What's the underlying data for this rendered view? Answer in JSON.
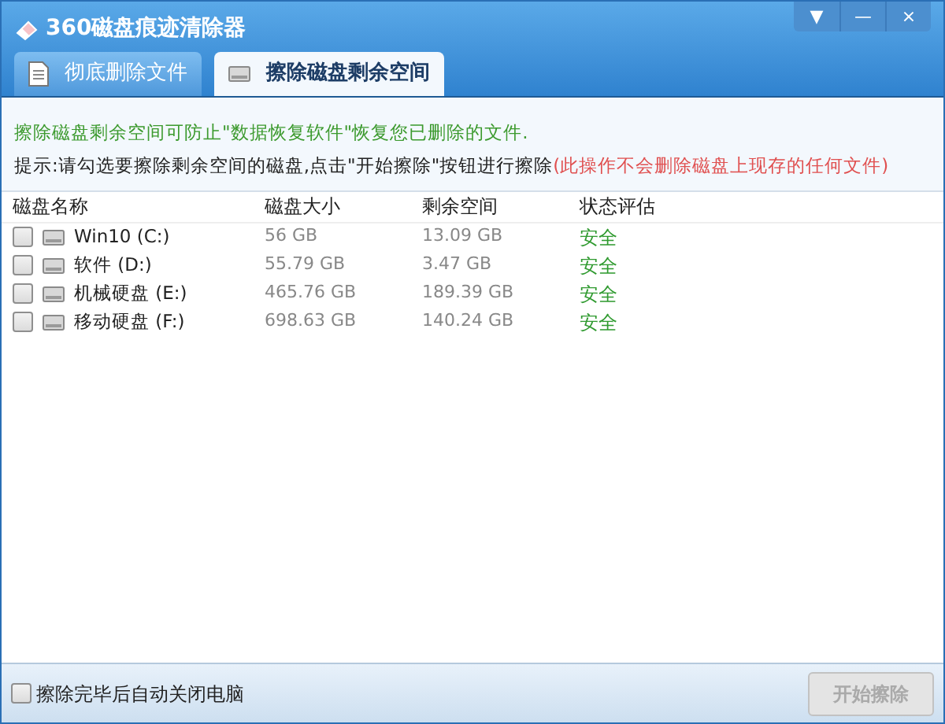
{
  "window": {
    "title": "360磁盘痕迹清除器",
    "controls": [
      "▼",
      "—",
      "×"
    ]
  },
  "tabs": [
    {
      "label": "彻底删除文件",
      "selected": false,
      "kind": "file"
    },
    {
      "label": "擦除磁盘剩余空间",
      "selected": true,
      "kind": "disk"
    }
  ],
  "info": {
    "note": "擦除磁盘剩余空间可防止\"数据恢复软件\"恢复您已删除的文件.",
    "hint": "提示:请勾选要擦除剩余空间的磁盘,点击\"开始擦除\"按钮进行擦除",
    "warning": "(此操作不会删除磁盘上现存的任何文件)"
  },
  "table": {
    "columns": [
      "磁盘名称",
      "磁盘大小",
      "剩余空间",
      "状态评估"
    ],
    "rows": [
      {
        "name": "Win10 (C:)",
        "size": "56 GB",
        "free": "13.09 GB",
        "status": "安全",
        "checked": false
      },
      {
        "name": "软件 (D:)",
        "size": "55.79 GB",
        "free": "3.47 GB",
        "status": "安全",
        "checked": false
      },
      {
        "name": "机械硬盘 (E:)",
        "size": "465.76 GB",
        "free": "189.39 GB",
        "status": "安全",
        "checked": false
      },
      {
        "name": "移动硬盘 (F:)",
        "size": "698.63 GB",
        "free": "140.24 GB",
        "status": "安全",
        "checked": false
      }
    ]
  },
  "footer": {
    "shutdown_label": "擦除完毕后自动关闭电脑",
    "shutdown_checked": false,
    "start_button": "开始擦除",
    "start_disabled": true
  }
}
